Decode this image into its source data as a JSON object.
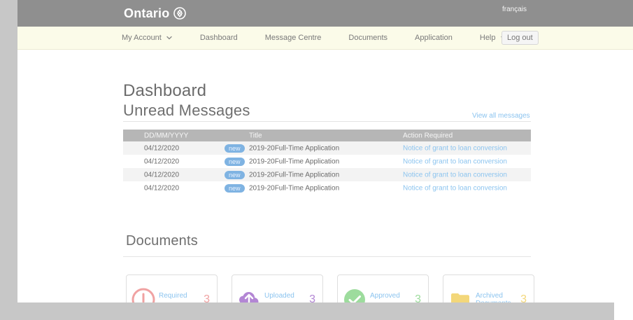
{
  "header": {
    "brand": "Ontario",
    "language_link": "français"
  },
  "nav": {
    "items": [
      {
        "label": "My Account",
        "has_dropdown": true
      },
      {
        "label": "Dashboard",
        "has_dropdown": false
      },
      {
        "label": "Message Centre",
        "has_dropdown": false
      },
      {
        "label": "Documents",
        "has_dropdown": false
      },
      {
        "label": "Application",
        "has_dropdown": false
      },
      {
        "label": "Help",
        "has_dropdown": true
      }
    ],
    "logout": "Log out"
  },
  "page": {
    "title": "Dashboard"
  },
  "unread_messages": {
    "title": "Unread Messages",
    "view_all": "View all messages",
    "table": {
      "headers": [
        "DD/MM/YYYY",
        "Title",
        "Action Required"
      ],
      "rows": [
        {
          "date": "04/12/2020",
          "badge": "new",
          "title": "2019-20Full-Time Application",
          "action": "Notice of grant to loan conversion"
        },
        {
          "date": "04/12/2020",
          "badge": "new",
          "title": "2019-20Full-Time Application",
          "action": "Notice of grant to loan conversion"
        },
        {
          "date": "04/12/2020",
          "badge": "new",
          "title": "2019-20Full-Time Application",
          "action": "Notice of grant to loan conversion"
        },
        {
          "date": "04/12/2020",
          "badge": "new",
          "title": "2019-20Full-Time Application",
          "action": "Notice of grant to loan conversion"
        }
      ]
    }
  },
  "documents": {
    "title": "Documents",
    "cards": [
      {
        "label": "Required",
        "count": "3",
        "icon": "alert-icon",
        "color": "#f0a2a2"
      },
      {
        "label": "Uploaded",
        "count": "3",
        "icon": "upload-icon",
        "color": "#b386d4"
      },
      {
        "label": "Approved",
        "count": "3",
        "icon": "check-icon",
        "color": "#9ddc9d"
      },
      {
        "label_line1": "Archived",
        "label_line2": "Documents",
        "count": "3",
        "icon": "folder-icon",
        "color": "#f3d77a"
      }
    ]
  },
  "colors": {
    "topbar": "#8f8f8f",
    "navbar": "#fbfbe9",
    "link": "#8cc4ef",
    "table_header": "#b6b6b6"
  }
}
